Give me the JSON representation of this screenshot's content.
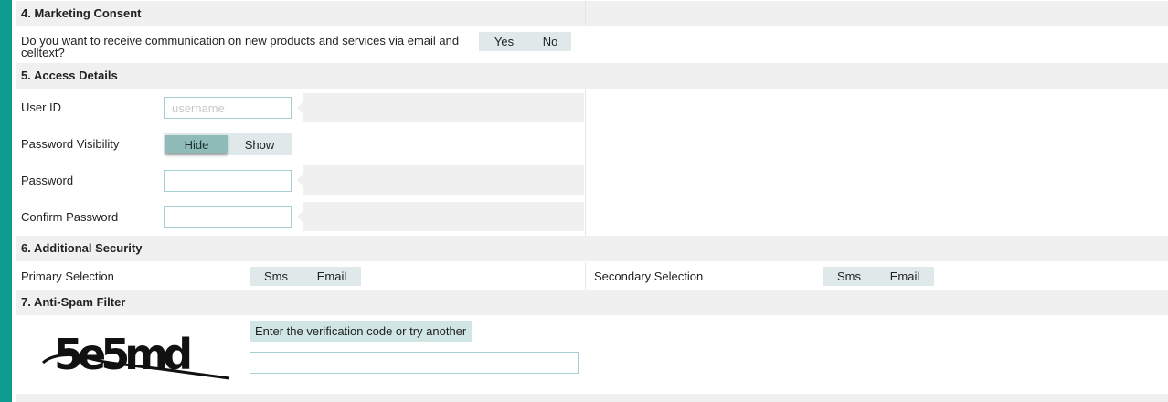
{
  "marketing": {
    "title": "4. Marketing Consent",
    "question_line1": "Do you want to receive communication on new products and services via email and",
    "question_line2": "celltext?",
    "yes_label": "Yes",
    "no_label": "No"
  },
  "access": {
    "title": "5. Access Details",
    "user_id_label": "User ID",
    "user_id_placeholder": "username",
    "user_id_value": "",
    "visibility_label": "Password Visibility",
    "hide_label": "Hide",
    "show_label": "Show",
    "selected_visibility": "Hide",
    "password_label": "Password",
    "password_value": "",
    "confirm_label": "Confirm Password",
    "confirm_value": ""
  },
  "security": {
    "title": "6. Additional Security",
    "primary_label": "Primary Selection",
    "primary_options": [
      "Sms",
      "Email"
    ],
    "secondary_label": "Secondary Selection",
    "secondary_options": [
      "Sms",
      "Email"
    ]
  },
  "antispam": {
    "title": "7. Anti-Spam Filter",
    "captcha_text": "5e5md",
    "verify_link": "Enter the verification code or try another",
    "verify_value": ""
  },
  "colors": {
    "accent_bar": "#0e9c8f",
    "toggle_bg": "#dfe9e9",
    "selected_bg": "#8fbcb8",
    "verify_bg": "#cfe6e5",
    "section_bg": "#f0f0f0"
  }
}
